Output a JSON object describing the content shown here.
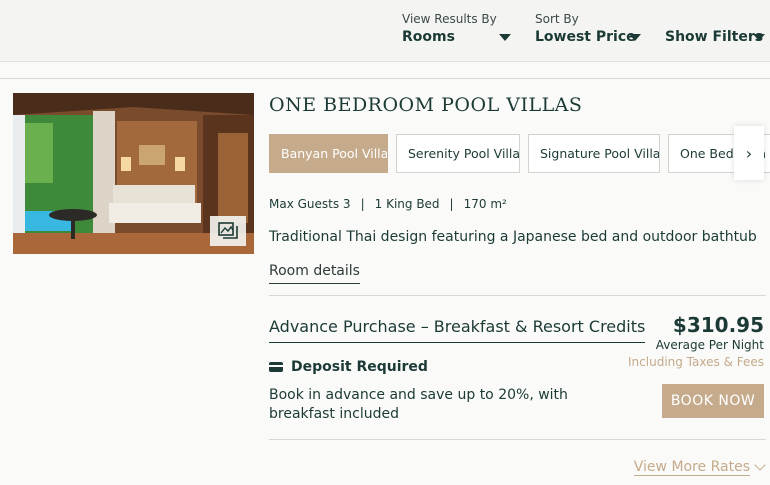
{
  "header": {
    "view_results": {
      "label": "View Results By",
      "value": "Rooms"
    },
    "sort": {
      "label": "Sort By",
      "value": "Lowest Price"
    },
    "filters": {
      "label": "Show Filters"
    }
  },
  "room": {
    "title": "ONE BEDROOM POOL VILLAS",
    "tabs": [
      {
        "label": "Banyan Pool Villa",
        "active": true
      },
      {
        "label": "Serenity Pool Villa"
      },
      {
        "label": "Signature Pool Villa"
      },
      {
        "label": "One Bedroom Pool Villa"
      }
    ],
    "max_guests": "Max Guests 3",
    "bed": "1 King Bed",
    "size": "170 m²",
    "description": "Traditional Thai design featuring a Japanese bed and outdoor bathtub",
    "details_link": "Room details"
  },
  "rate": {
    "name": "Advance Purchase – Breakfast & Resort Credits",
    "price": "$310.95",
    "per_night": "Average Per Night",
    "taxes": "Including Taxes & Fees",
    "deposit": "Deposit Required",
    "description": "Book in advance and save up to 20%, with breakfast included",
    "book_label": "BOOK NOW"
  },
  "more_rates": "View More Rates",
  "colors": {
    "accent": "#c5ab8b",
    "text": "#1c3a35"
  }
}
